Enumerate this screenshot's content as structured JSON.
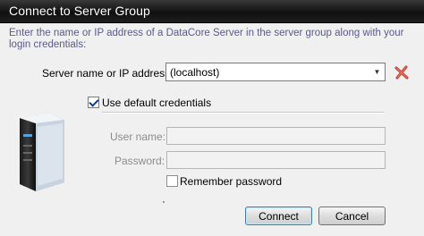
{
  "window": {
    "title": "Connect to Server Group"
  },
  "instruction": "Enter the name or IP address of a DataCore Server in the server group along with your login credentials:",
  "server": {
    "label": "Server name or IP address:",
    "value": "(localhost)",
    "dropdown_icon": "chevron-down-icon",
    "remove_icon": "remove-x-icon"
  },
  "use_default_credentials": {
    "label": "Use default credentials",
    "checked": true
  },
  "username": {
    "label": "User name:",
    "value": "",
    "disabled": true
  },
  "password": {
    "label": "Password:",
    "value": "",
    "disabled": true
  },
  "remember_password": {
    "label": "Remember password",
    "checked": false
  },
  "buttons": {
    "connect": "Connect",
    "cancel": "Cancel"
  },
  "colors": {
    "title_bar": "#101010",
    "instruction_text": "#5a5a8a",
    "remove_icon": "#c0392b",
    "disabled_label": "#8c8c8c"
  }
}
